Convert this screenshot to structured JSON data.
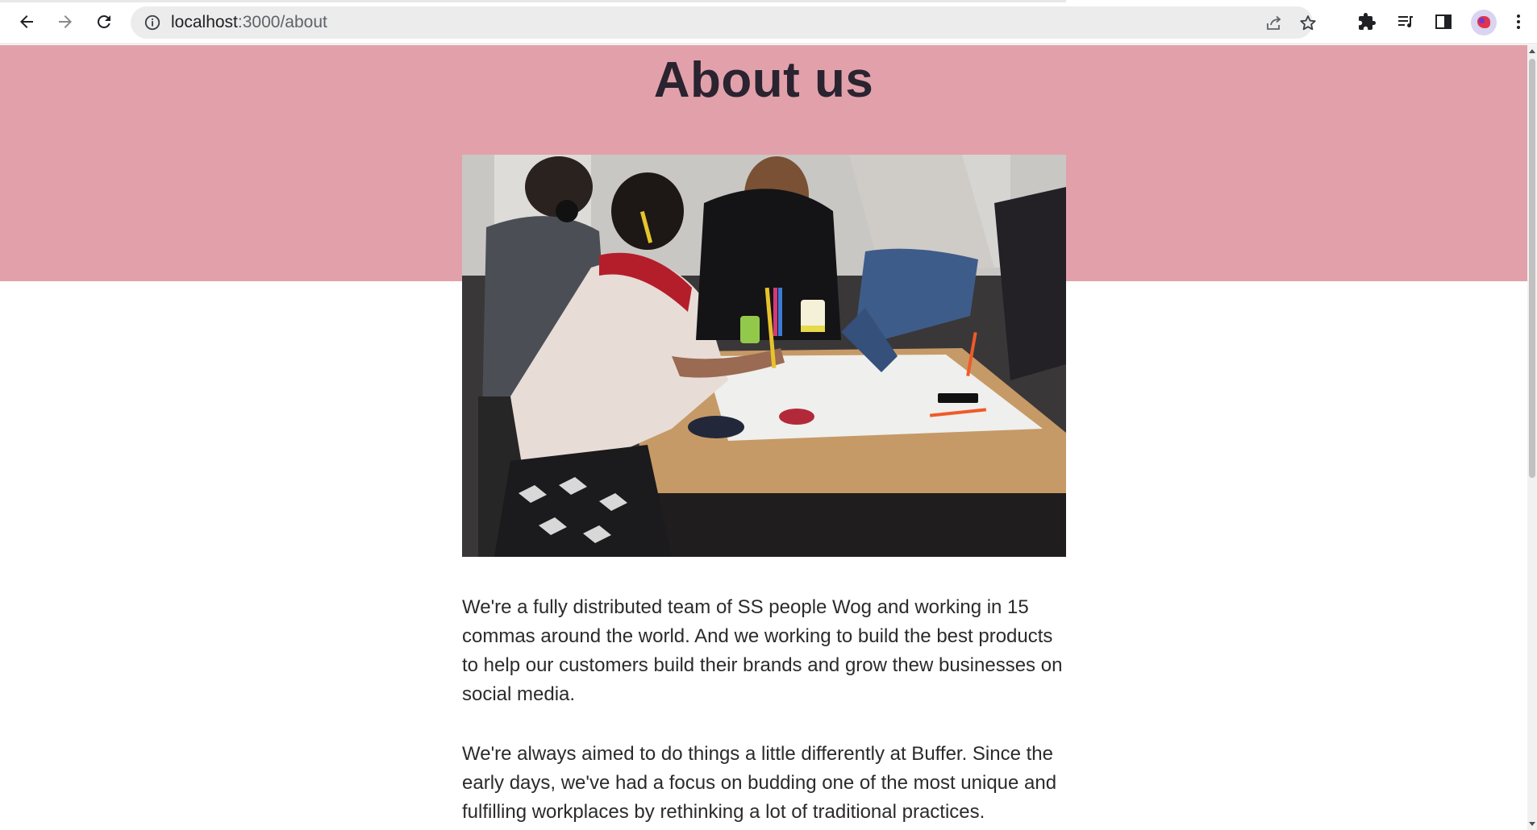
{
  "browser": {
    "url_host": "localhost",
    "url_path": ":3000/about",
    "icons": {
      "back": "arrow-left-icon",
      "forward": "arrow-right-icon",
      "reload": "reload-icon",
      "site_info": "info-icon",
      "share": "share-icon",
      "bookmark": "star-icon",
      "extensions": "puzzle-icon",
      "media": "playlist-icon",
      "side_panel": "side-panel-icon",
      "profile": "avatar",
      "menu": "more-vertical-icon"
    }
  },
  "page": {
    "title": "About us",
    "hero_color": "#e2a1aa",
    "paragraphs": [
      "We're a fully distributed team of SS people Wog and working in 15 commas around the world. And we working to build the best products to help our customers build their brands and grow thew businesses on social media.",
      "We're always aimed to do things a little differently at Buffer. Since the early days, we've had a focus on budding one of the most unique and fulfilling workplaces by rethinking a lot of traditional practices."
    ]
  }
}
